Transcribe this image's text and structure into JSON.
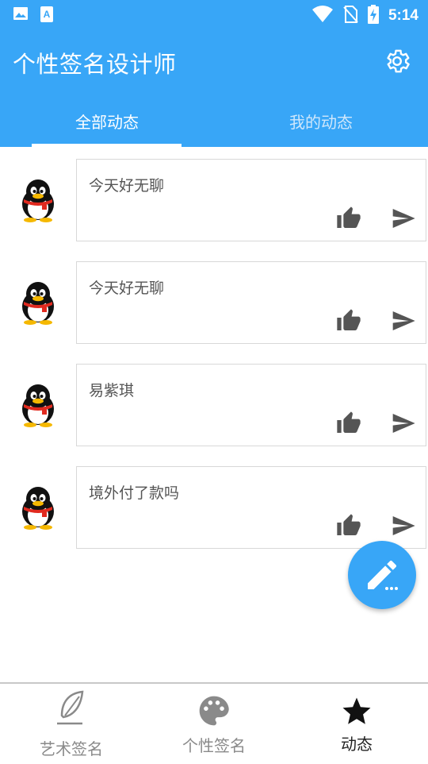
{
  "status_bar": {
    "time": "5:14",
    "icons": [
      "image-notification-icon",
      "text-notification-icon",
      "wifi-icon",
      "no-sim-icon",
      "battery-charging-icon"
    ]
  },
  "app_bar": {
    "title": "个性签名设计师",
    "settings_icon": "gear-icon"
  },
  "tabs": [
    {
      "label": "全部动态",
      "active": true
    },
    {
      "label": "我的动态",
      "active": false
    }
  ],
  "posts": [
    {
      "text": "今天好无聊"
    },
    {
      "text": "今天好无聊"
    },
    {
      "text": "易紫琪"
    },
    {
      "text": "境外付了款吗"
    }
  ],
  "fab": {
    "icon": "edit-pencil-icon"
  },
  "bottom_nav": [
    {
      "label": "艺术签名",
      "icon": "feather-icon",
      "active": false
    },
    {
      "label": "个性签名",
      "icon": "palette-icon",
      "active": false
    },
    {
      "label": "动态",
      "icon": "star-icon",
      "active": true
    }
  ],
  "colors": {
    "primary": "#38a6f7",
    "card_border": "#d8d8d8",
    "icon_gray": "#555555"
  }
}
